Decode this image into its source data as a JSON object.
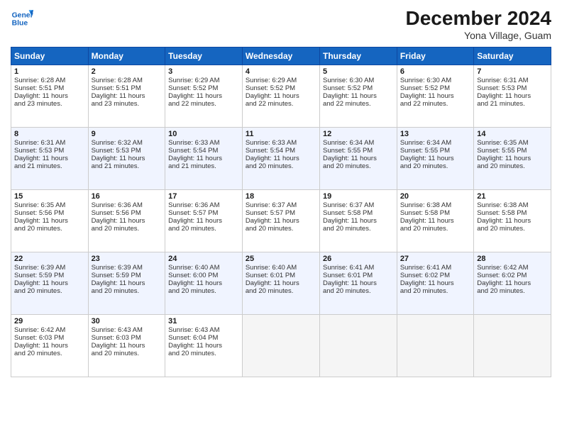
{
  "header": {
    "logo_line1": "General",
    "logo_line2": "Blue",
    "month": "December 2024",
    "location": "Yona Village, Guam"
  },
  "weekdays": [
    "Sunday",
    "Monday",
    "Tuesday",
    "Wednesday",
    "Thursday",
    "Friday",
    "Saturday"
  ],
  "weeks": [
    [
      {
        "day": "1",
        "info": "Sunrise: 6:28 AM\nSunset: 5:51 PM\nDaylight: 11 hours and 23 minutes."
      },
      {
        "day": "2",
        "info": "Sunrise: 6:28 AM\nSunset: 5:51 PM\nDaylight: 11 hours and 23 minutes."
      },
      {
        "day": "3",
        "info": "Sunrise: 6:29 AM\nSunset: 5:52 PM\nDaylight: 11 hours and 22 minutes."
      },
      {
        "day": "4",
        "info": "Sunrise: 6:29 AM\nSunset: 5:52 PM\nDaylight: 11 hours and 22 minutes."
      },
      {
        "day": "5",
        "info": "Sunrise: 6:30 AM\nSunset: 5:52 PM\nDaylight: 11 hours and 22 minutes."
      },
      {
        "day": "6",
        "info": "Sunrise: 6:30 AM\nSunset: 5:52 PM\nDaylight: 11 hours and 22 minutes."
      },
      {
        "day": "7",
        "info": "Sunrise: 6:31 AM\nSunset: 5:53 PM\nDaylight: 11 hours and 21 minutes."
      }
    ],
    [
      {
        "day": "8",
        "info": "Sunrise: 6:31 AM\nSunset: 5:53 PM\nDaylight: 11 hours and 21 minutes."
      },
      {
        "day": "9",
        "info": "Sunrise: 6:32 AM\nSunset: 5:53 PM\nDaylight: 11 hours and 21 minutes."
      },
      {
        "day": "10",
        "info": "Sunrise: 6:33 AM\nSunset: 5:54 PM\nDaylight: 11 hours and 21 minutes."
      },
      {
        "day": "11",
        "info": "Sunrise: 6:33 AM\nSunset: 5:54 PM\nDaylight: 11 hours and 20 minutes."
      },
      {
        "day": "12",
        "info": "Sunrise: 6:34 AM\nSunset: 5:55 PM\nDaylight: 11 hours and 20 minutes."
      },
      {
        "day": "13",
        "info": "Sunrise: 6:34 AM\nSunset: 5:55 PM\nDaylight: 11 hours and 20 minutes."
      },
      {
        "day": "14",
        "info": "Sunrise: 6:35 AM\nSunset: 5:55 PM\nDaylight: 11 hours and 20 minutes."
      }
    ],
    [
      {
        "day": "15",
        "info": "Sunrise: 6:35 AM\nSunset: 5:56 PM\nDaylight: 11 hours and 20 minutes."
      },
      {
        "day": "16",
        "info": "Sunrise: 6:36 AM\nSunset: 5:56 PM\nDaylight: 11 hours and 20 minutes."
      },
      {
        "day": "17",
        "info": "Sunrise: 6:36 AM\nSunset: 5:57 PM\nDaylight: 11 hours and 20 minutes."
      },
      {
        "day": "18",
        "info": "Sunrise: 6:37 AM\nSunset: 5:57 PM\nDaylight: 11 hours and 20 minutes."
      },
      {
        "day": "19",
        "info": "Sunrise: 6:37 AM\nSunset: 5:58 PM\nDaylight: 11 hours and 20 minutes."
      },
      {
        "day": "20",
        "info": "Sunrise: 6:38 AM\nSunset: 5:58 PM\nDaylight: 11 hours and 20 minutes."
      },
      {
        "day": "21",
        "info": "Sunrise: 6:38 AM\nSunset: 5:58 PM\nDaylight: 11 hours and 20 minutes."
      }
    ],
    [
      {
        "day": "22",
        "info": "Sunrise: 6:39 AM\nSunset: 5:59 PM\nDaylight: 11 hours and 20 minutes."
      },
      {
        "day": "23",
        "info": "Sunrise: 6:39 AM\nSunset: 5:59 PM\nDaylight: 11 hours and 20 minutes."
      },
      {
        "day": "24",
        "info": "Sunrise: 6:40 AM\nSunset: 6:00 PM\nDaylight: 11 hours and 20 minutes."
      },
      {
        "day": "25",
        "info": "Sunrise: 6:40 AM\nSunset: 6:01 PM\nDaylight: 11 hours and 20 minutes."
      },
      {
        "day": "26",
        "info": "Sunrise: 6:41 AM\nSunset: 6:01 PM\nDaylight: 11 hours and 20 minutes."
      },
      {
        "day": "27",
        "info": "Sunrise: 6:41 AM\nSunset: 6:02 PM\nDaylight: 11 hours and 20 minutes."
      },
      {
        "day": "28",
        "info": "Sunrise: 6:42 AM\nSunset: 6:02 PM\nDaylight: 11 hours and 20 minutes."
      }
    ],
    [
      {
        "day": "29",
        "info": "Sunrise: 6:42 AM\nSunset: 6:03 PM\nDaylight: 11 hours and 20 minutes."
      },
      {
        "day": "30",
        "info": "Sunrise: 6:43 AM\nSunset: 6:03 PM\nDaylight: 11 hours and 20 minutes."
      },
      {
        "day": "31",
        "info": "Sunrise: 6:43 AM\nSunset: 6:04 PM\nDaylight: 11 hours and 20 minutes."
      },
      null,
      null,
      null,
      null
    ]
  ]
}
